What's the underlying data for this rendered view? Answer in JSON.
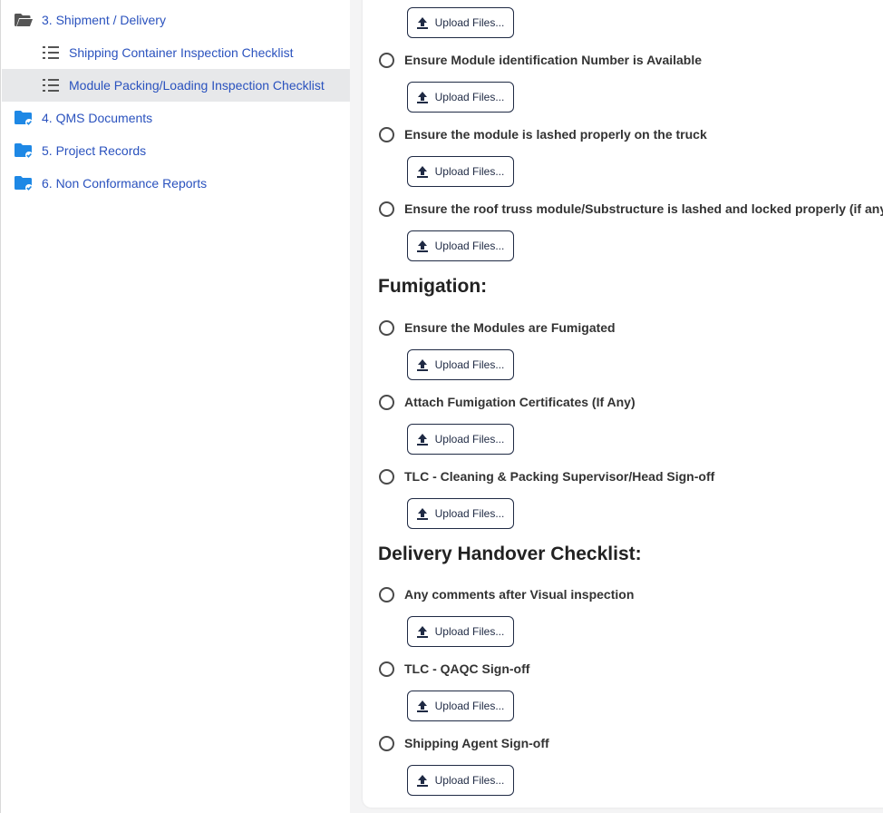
{
  "sidebar": {
    "items": [
      {
        "label": "3. Shipment / Delivery",
        "icon": "folder-open-icon",
        "type": "folder"
      },
      {
        "label": "Shipping Container Inspection Checklist",
        "icon": "list-icon",
        "type": "checklist"
      },
      {
        "label": "Module Packing/Loading Inspection Checklist",
        "icon": "list-icon",
        "type": "checklist",
        "selected": true
      },
      {
        "label": "4. QMS Documents",
        "icon": "folder-check-icon",
        "type": "folder"
      },
      {
        "label": "5. Project Records",
        "icon": "folder-check-icon",
        "type": "folder"
      },
      {
        "label": "6. Non Conformance Reports",
        "icon": "folder-check-icon",
        "type": "folder"
      }
    ]
  },
  "upload_label": "Upload Files...",
  "checklist": {
    "items": [
      {
        "label": "Ensure Module identification Number is Available"
      },
      {
        "label": "Ensure the module is lashed properly on the truck"
      },
      {
        "label": "Ensure the roof truss module/Substructure is lashed and locked properly (if any)"
      }
    ]
  },
  "fumigation": {
    "title": "Fumigation:",
    "items": [
      {
        "label": "Ensure the Modules are Fumigated"
      },
      {
        "label": "Attach Fumigation Certificates (If Any)"
      },
      {
        "label": "TLC - Cleaning & Packing Supervisor/Head Sign-off"
      }
    ]
  },
  "handover": {
    "title": "Delivery Handover Checklist:",
    "items": [
      {
        "label": "Any comments after Visual inspection"
      },
      {
        "label": "TLC - QAQC Sign-off"
      },
      {
        "label": "Shipping Agent Sign-off"
      }
    ]
  },
  "colors": {
    "link": "#2a52be",
    "folder": "#1e88e5",
    "selected_bg": "#e7e8ea",
    "button_border": "#1f2a44"
  }
}
